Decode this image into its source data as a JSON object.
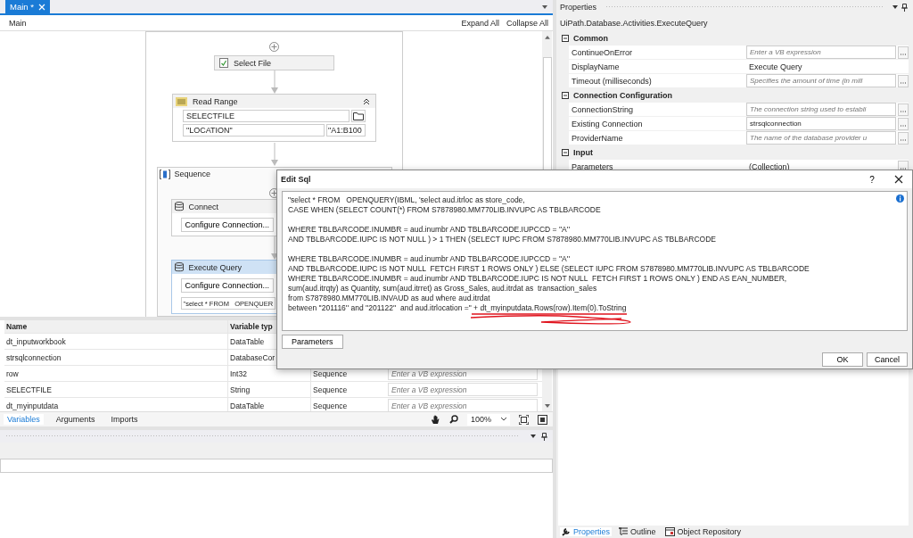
{
  "designer_tab": {
    "label": "Main *",
    "selected": true
  },
  "breadcrumb": "Main",
  "expand_all": "Expand All",
  "collapse_all": "Collapse All",
  "workflow": {
    "select_file": {
      "title": "Select File"
    },
    "read_range": {
      "title": "Read Range",
      "path": "SELECTFILE",
      "sheet": "\"LOCATION\"",
      "range": "\"A1:B100"
    },
    "sequence": {
      "title": "Sequence",
      "activities": [
        {
          "kind": "connect",
          "title": "Connect",
          "selected": false,
          "button": "Configure Connection..."
        },
        {
          "kind": "query",
          "title": "Execute Query",
          "selected": true,
          "button": "Configure Connection...",
          "query": "\"select * FROM   OPENQUER"
        }
      ]
    }
  },
  "variables": {
    "columns": [
      "Name",
      "Variable typ"
    ],
    "rows": [
      {
        "name": "dt_inputworkbook",
        "type": "DataTable"
      },
      {
        "name": "strsqlconnection",
        "type": "DatabaseCor"
      },
      {
        "name": "row",
        "type": "Int32",
        "scope": "Sequence",
        "default_placeholder": "Enter a VB expression"
      },
      {
        "name": "SELECTFILE",
        "type": "String",
        "scope": "Sequence",
        "default_placeholder": "Enter a VB expression"
      },
      {
        "name": "dt_myinputdata",
        "type": "DataTable",
        "scope": "Sequence",
        "default_placeholder": "Enter a VB expression"
      }
    ]
  },
  "bottom_tabs": [
    {
      "label": "Variables",
      "selected": true
    },
    {
      "label": "Arguments",
      "selected": false
    },
    {
      "label": "Imports",
      "selected": false
    }
  ],
  "zoom": "100%",
  "properties": {
    "title": "Properties",
    "type_name": "UiPath.Database.Activities.ExecuteQuery",
    "categories": [
      {
        "name": "Common",
        "rows": [
          {
            "kind": "expression",
            "name": "ContinueOnError",
            "placeholder": "Enter a VB expression"
          },
          {
            "kind": "plain",
            "name": "DisplayName",
            "value": "Execute Query"
          },
          {
            "kind": "expression",
            "name": "Timeout (milliseconds)",
            "placeholder": "Specifies the amount of time (in mill"
          }
        ]
      },
      {
        "name": "Connection Configuration",
        "rows": [
          {
            "kind": "expression",
            "name": "ConnectionString",
            "placeholder": "The connection string used to establi"
          },
          {
            "kind": "expression",
            "name": "Existing Connection",
            "value": "strsqlconnection"
          },
          {
            "kind": "expression",
            "name": "ProviderName",
            "placeholder": "The name of the database provider u"
          }
        ]
      },
      {
        "name": "Input",
        "rows": [
          {
            "kind": "collection",
            "name": "Parameters",
            "value": "(Collection)"
          }
        ]
      }
    ]
  },
  "panel_tabs": [
    {
      "label": "Properties",
      "selected": true
    },
    {
      "label": "Outline",
      "selected": false
    },
    {
      "label": "Object Repository",
      "selected": false
    }
  ],
  "dialog": {
    "title": "Edit Sql",
    "help_glyph": "?",
    "sql_blocks": [
      [
        "\"select * FROM   OPENQUERY(IBML, 'select aud.itrloc as store_code,",
        "CASE WHEN (SELECT COUNT(*) FROM S7878980.MM770LIB.INVUPC AS TBLBARCODE"
      ],
      [
        "WHERE TBLBARCODE.INUMBR = aud.inumbr AND TBLBARCODE.IUPCCD = ''A''",
        "AND TBLBARCODE.IUPC IS NOT NULL ) > 1 THEN (SELECT IUPC FROM S7878980.MM770LIB.INVUPC AS TBLBARCODE"
      ],
      [
        "WHERE TBLBARCODE.INUMBR = aud.inumbr AND TBLBARCODE.IUPCCD = ''A''",
        "AND TBLBARCODE.IUPC IS NOT NULL  FETCH FIRST 1 ROWS ONLY ) ELSE (SELECT IUPC FROM S7878980.MM770LIB.INVUPC AS TBLBARCODE",
        "WHERE TBLBARCODE.INUMBR = aud.inumbr AND TBLBARCODE.IUPC IS NOT NULL  FETCH FIRST 1 ROWS ONLY ) END AS EAN_NUMBER,",
        "sum(aud.itrqty) as Quantity, sum(aud.itrret) as Gross_Sales, aud.itrdat as  transaction_sales",
        "from S7878980.MM770LIB.INVAUD as aud where aud.itrdat",
        "between ''201116'' and ''201122''  and aud.itrlocation =\" + dt_myinputdata.Rows(row).Item(0).ToString"
      ]
    ],
    "parameters_button": "Parameters",
    "buttons": [
      "OK",
      "Cancel"
    ]
  }
}
